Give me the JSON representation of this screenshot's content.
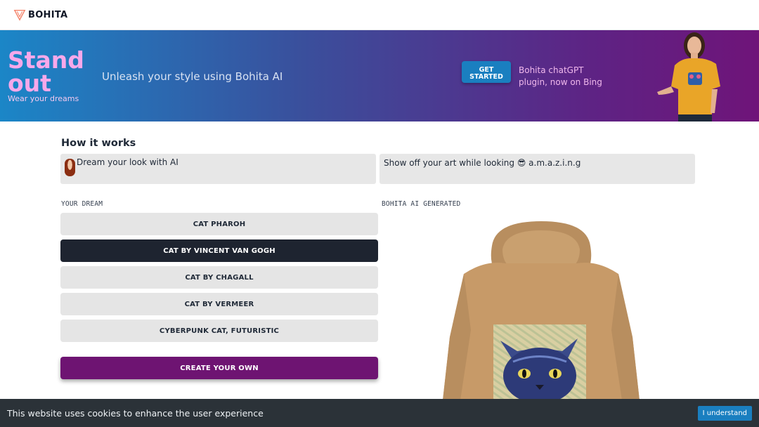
{
  "brand": {
    "name": "BOHITA",
    "logo_icon": "v-chevron-logo-icon",
    "accent_color": "#f4846b"
  },
  "hero": {
    "title_line1": "Stand",
    "title_line2": "out",
    "subtitle": "Wear your dreams",
    "tagline": "Unleash your style using Bohita AI",
    "cta_line1": "GET",
    "cta_line2": "STARTED",
    "plugin_note": "Bohita chatGPT plugin, now on Bing",
    "gradient_colors": [
      "#1b86c7",
      "#6f1479"
    ]
  },
  "how_it_works": {
    "title": "How it works",
    "step1": "Dream your look with AI",
    "step2": "Show off your art while looking 😎 a.m.a.z.i.n.g"
  },
  "dreams": {
    "label": "YOUR DREAM",
    "items": [
      {
        "label": "CAT PHAROH"
      },
      {
        "label": "CAT BY VINCENT VAN GOGH"
      },
      {
        "label": "CAT BY CHAGALL"
      },
      {
        "label": "CAT BY VERMEER"
      },
      {
        "label": "CYBERPUNK CAT, FUTURISTIC"
      }
    ],
    "selected_index": 1,
    "create_label": "CREATE YOUR OWN"
  },
  "generated": {
    "label": "BOHITA AI GENERATED"
  },
  "cookie": {
    "text": "This website uses cookies to enhance the user experience",
    "button": "I understand"
  }
}
